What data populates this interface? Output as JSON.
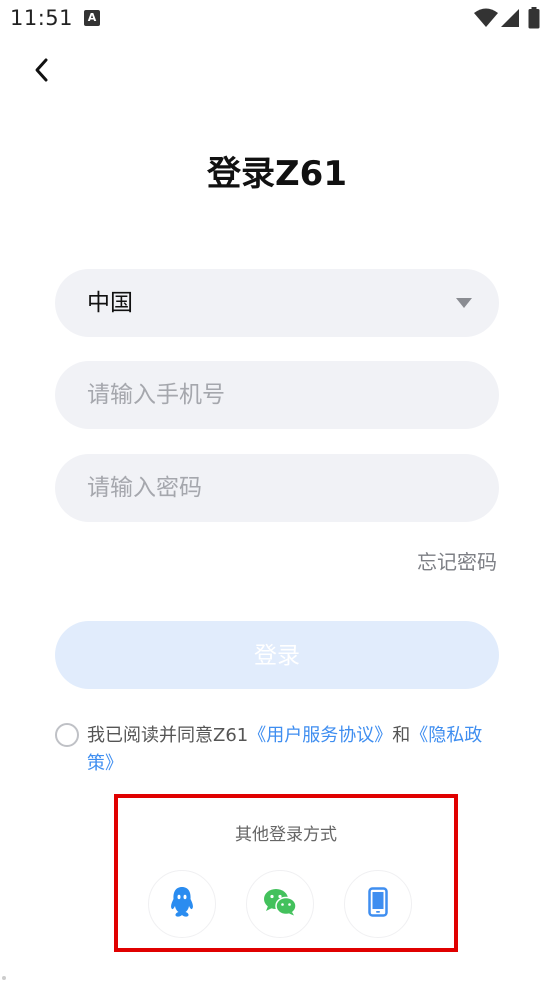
{
  "status_bar": {
    "time": "11:51",
    "notification_icon": "text-a-icon",
    "wifi_icon": "wifi-icon",
    "signal_icon": "signal-icon",
    "battery_icon": "battery-icon"
  },
  "header": {
    "back_icon": "chevron-left-icon",
    "title": "登录Z61"
  },
  "form": {
    "country_value": "中国",
    "phone_placeholder": "请输入手机号",
    "password_placeholder": "请输入密码",
    "forgot_password": "忘记密码",
    "login_label": "登录"
  },
  "agreement": {
    "prefix": "我已阅读并同意Z61",
    "terms_link": "《用户服务协议》",
    "conjunction": "和",
    "privacy_link": "《隐私政策》"
  },
  "other_login": {
    "title": "其他登录方式",
    "options": [
      "qq-icon",
      "wechat-icon",
      "mobile-phone-icon"
    ]
  },
  "colors": {
    "accent": "#3f8ef0",
    "field_bg": "#f1f2f6",
    "login_disabled": "#e1ecfc",
    "highlight_border": "#e00000",
    "qq_blue": "#2a8cf0",
    "wechat_green": "#43c15c"
  }
}
